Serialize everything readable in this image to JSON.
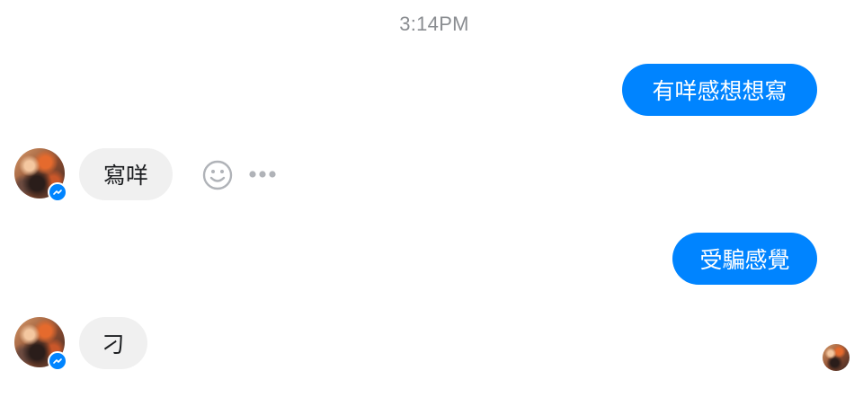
{
  "timestamp": "3:14PM",
  "messages": [
    {
      "direction": "outgoing",
      "text": "有咩感想想寫"
    },
    {
      "direction": "incoming",
      "text": "寫咩"
    },
    {
      "direction": "outgoing",
      "text": "受騙感覺"
    },
    {
      "direction": "incoming",
      "text": "刁"
    }
  ],
  "actions": {
    "react_icon": "smiley-face-icon",
    "more_icon": "more-horizontal-icon"
  },
  "colors": {
    "outgoing_bubble": "#0084ff",
    "incoming_bubble": "#f0f0f0",
    "timestamp": "#8a8d91",
    "messenger_badge": "#0084ff",
    "action_icon": "#b0b3b8"
  }
}
